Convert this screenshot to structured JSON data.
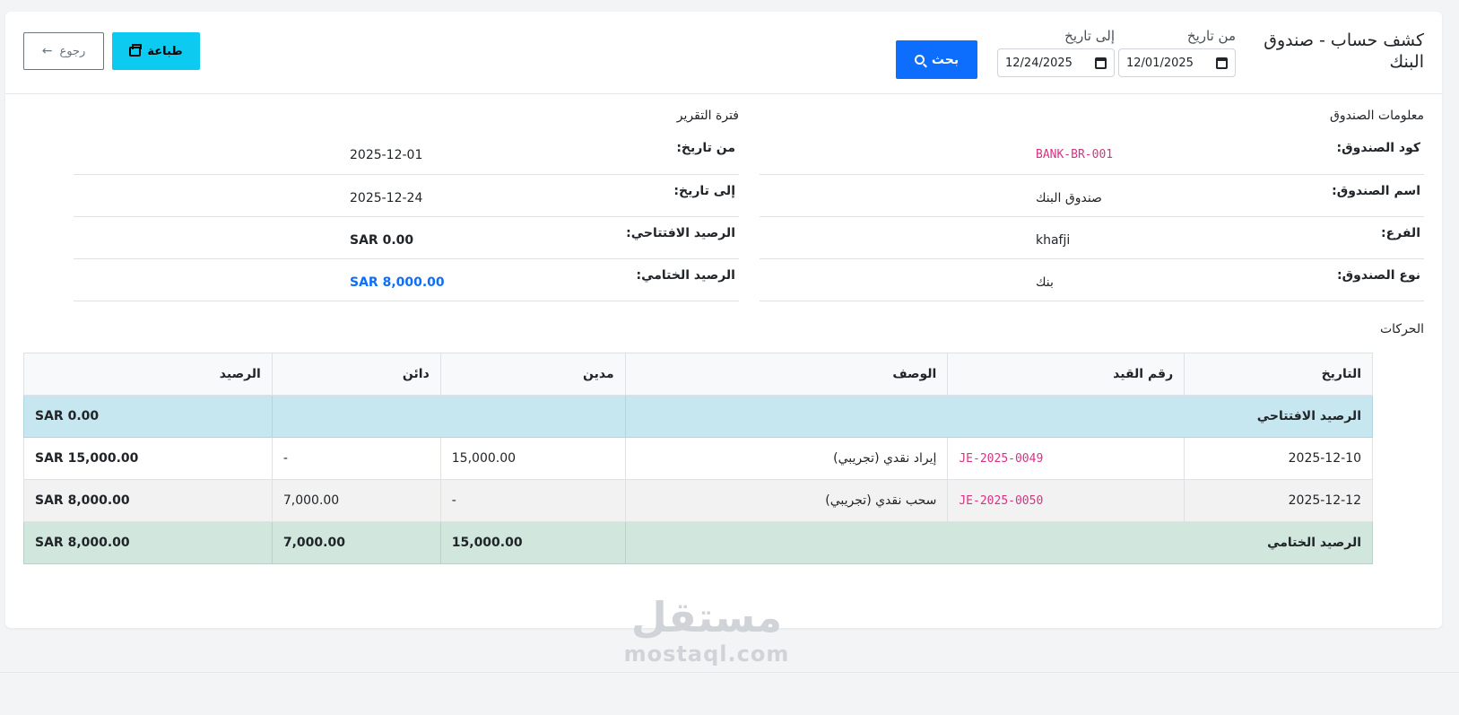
{
  "header": {
    "title": "كشف حساب - صندوق البنك",
    "from_label": "من تاريخ",
    "from_value": "12/01/2025",
    "to_label": "إلى تاريخ",
    "to_value": "12/24/2025",
    "search_label": "بحث",
    "print_label": "طباعة",
    "back_label": "رجوع"
  },
  "box_info": {
    "title": "معلومات الصندوق",
    "rows": [
      {
        "label": "كود الصندوق:",
        "value": "BANK-BR-001"
      },
      {
        "label": "اسم الصندوق:",
        "value": "صندوق البنك"
      },
      {
        "label": "الفرع:",
        "value": "khafji"
      },
      {
        "label": "نوع الصندوق:",
        "value": "بنك"
      }
    ]
  },
  "period": {
    "title": "فترة التقرير",
    "rows": [
      {
        "label": "من تاريخ:",
        "value": "2025-12-01"
      },
      {
        "label": "إلى تاريخ:",
        "value": "2025-12-24"
      },
      {
        "label": "الرصيد الافتتاحي:",
        "value": "SAR 0.00"
      },
      {
        "label": "الرصيد الختامي:",
        "value": "SAR 8,000.00"
      }
    ]
  },
  "transactions": {
    "title": "الحركات",
    "columns": [
      "التاريخ",
      "رقم القيد",
      "الوصف",
      "مدين",
      "دائن",
      "الرصيد"
    ],
    "opening": {
      "label": "الرصيد الافتتاحي",
      "balance": "SAR 0.00"
    },
    "rows": [
      {
        "date": "2025-12-10",
        "entry": "JE-2025-0049",
        "desc": "إيراد نقدي (تجريبي)",
        "debit": "15,000.00",
        "credit": "-",
        "balance": "SAR 15,000.00"
      },
      {
        "date": "2025-12-12",
        "entry": "JE-2025-0050",
        "desc": "سحب نقدي (تجريبي)",
        "debit": "-",
        "credit": "7,000.00",
        "balance": "SAR 8,000.00"
      }
    ],
    "closing": {
      "label": "الرصيد الختامي",
      "debit": "15,000.00",
      "credit": "7,000.00",
      "balance": "SAR 8,000.00"
    }
  },
  "watermark": {
    "arabic": "مستقل",
    "latin": "mostaql.com"
  },
  "colors": {
    "primary": "#0d6efd",
    "info": "#0dcaf0",
    "code": "#d63384",
    "opening_row": "#c6e7ef",
    "closing_row": "#d1e7dd"
  }
}
